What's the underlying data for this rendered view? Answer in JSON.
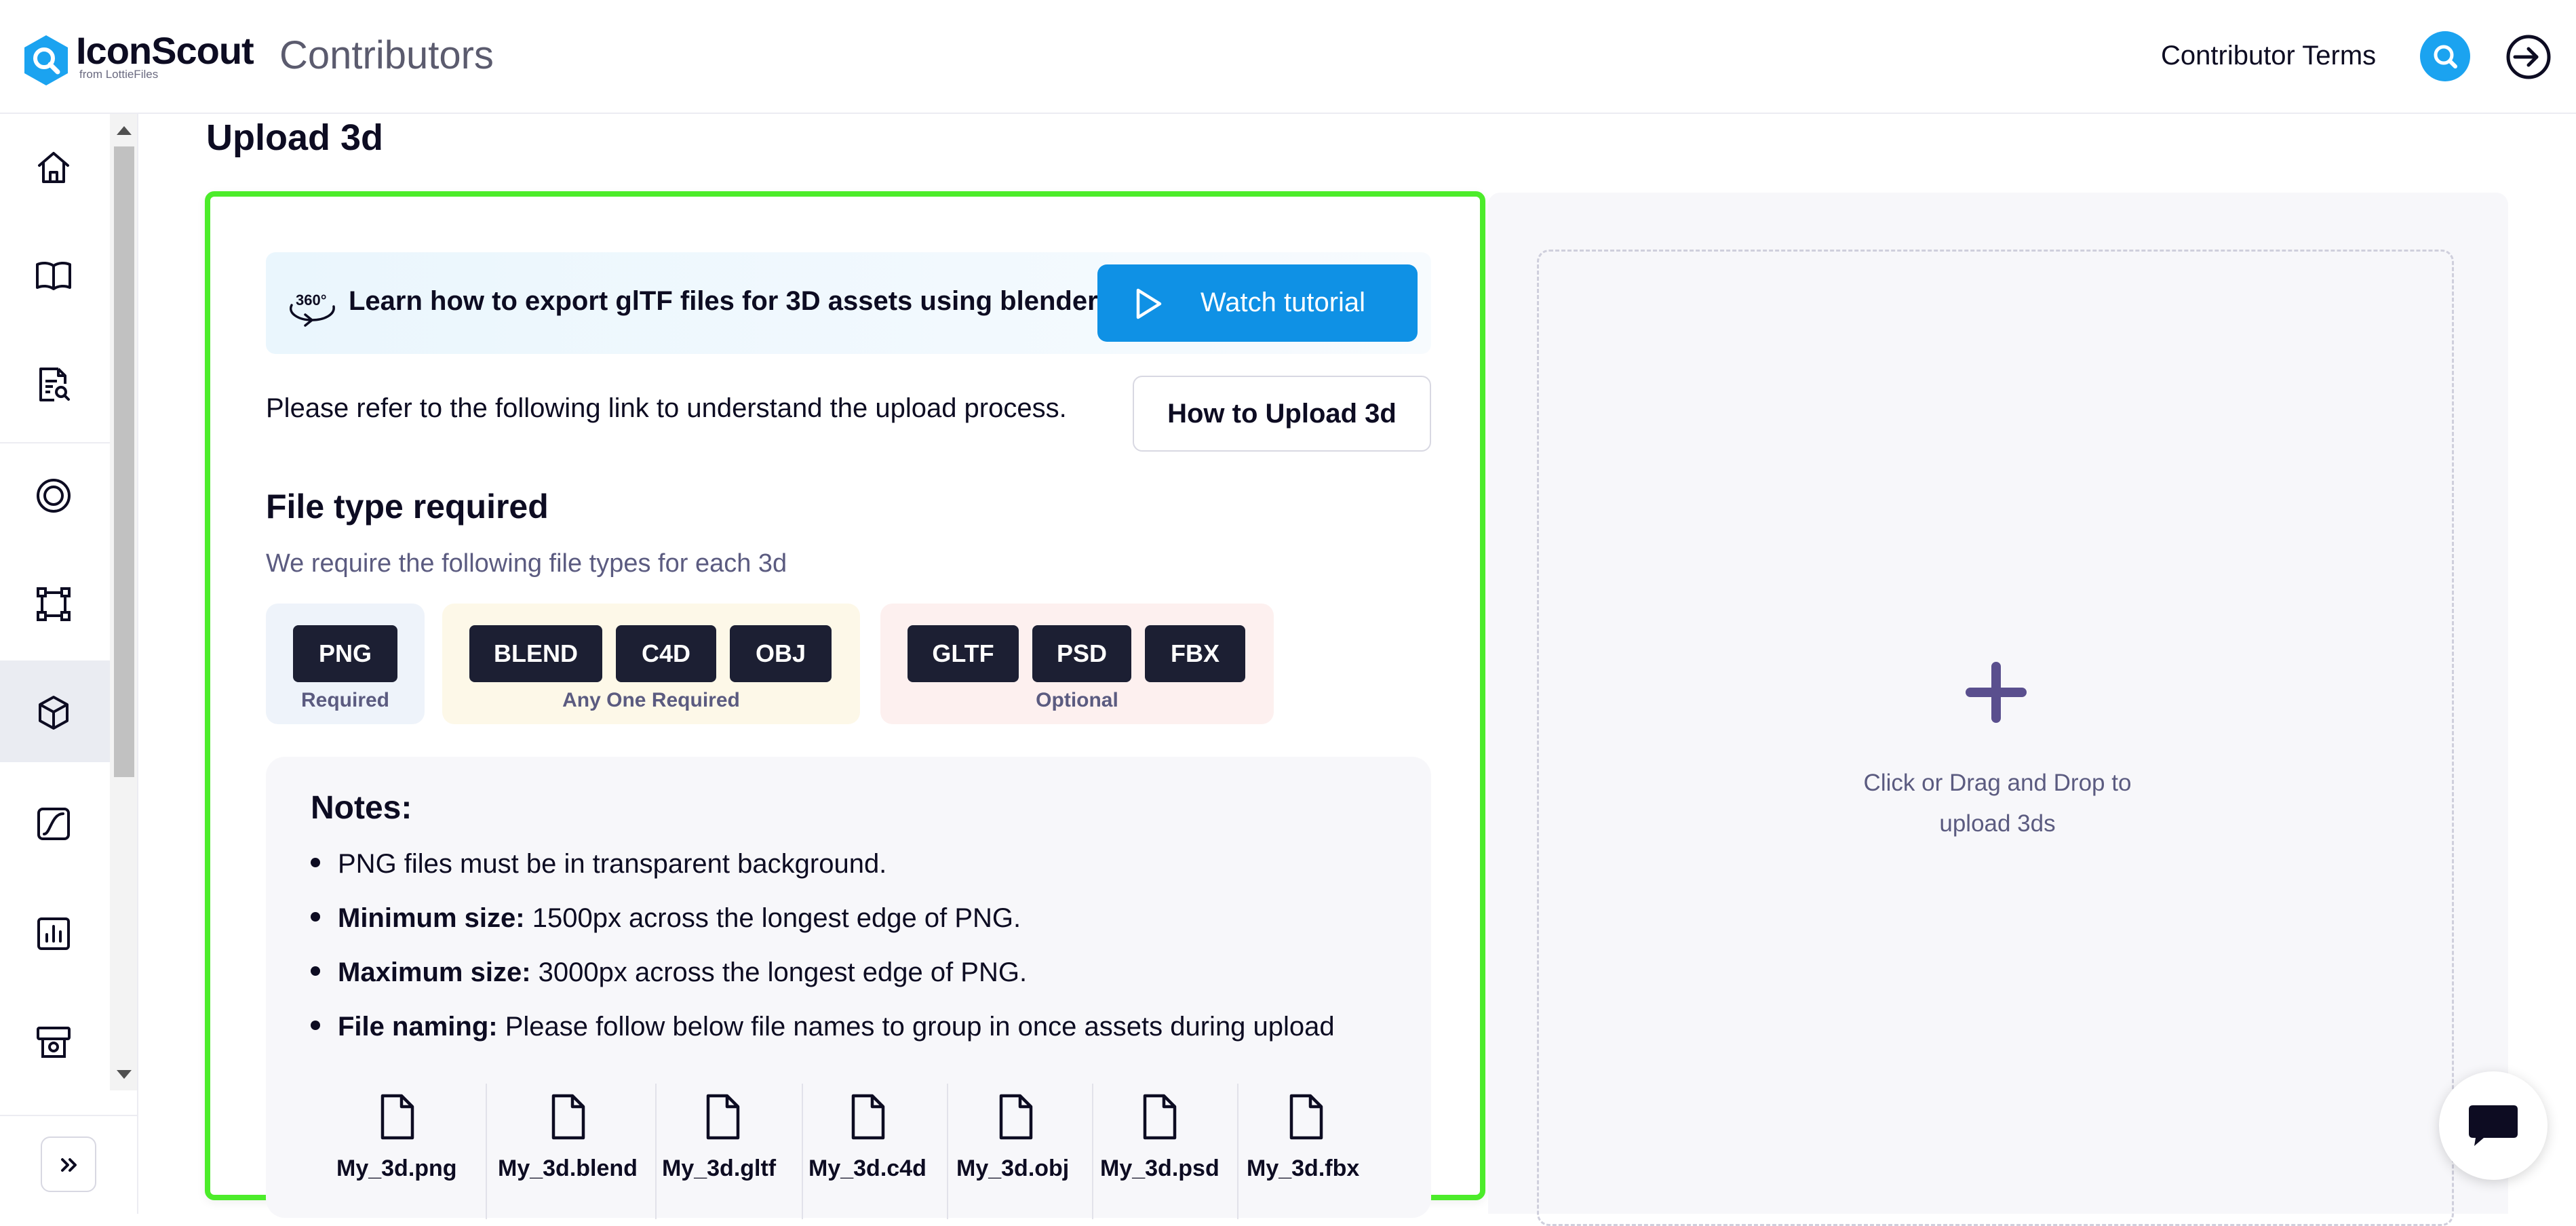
{
  "brand": {
    "name": "IconScout",
    "sub": "from LottieFiles",
    "section": "Contributors",
    "accent": "#0f91e5",
    "highlight": "#4cec2a"
  },
  "header": {
    "terms": "Contributor Terms",
    "avatar_icon": "user-avatar-icon",
    "logout_icon": "logout-icon"
  },
  "sidebar": {
    "items": [
      {
        "name": "home",
        "icon": "home-icon"
      },
      {
        "name": "guidelines",
        "icon": "open-book-icon"
      },
      {
        "name": "review",
        "icon": "document-search-icon"
      },
      {
        "name": "lottie",
        "icon": "target-icon"
      },
      {
        "name": "illustrations",
        "icon": "vector-square-icon"
      },
      {
        "name": "3d",
        "icon": "cube-icon",
        "active": true
      },
      {
        "name": "animations",
        "icon": "curve-icon"
      },
      {
        "name": "analytics",
        "icon": "bar-chart-icon"
      },
      {
        "name": "earnings",
        "icon": "atm-icon"
      }
    ],
    "expand_icon": "double-chevron-right-icon"
  },
  "page": {
    "title": "Upload 3d"
  },
  "tutorial": {
    "text": "Learn how to export glTF files for 3D assets using blender",
    "button": "Watch tutorial"
  },
  "refer": {
    "text": "Please refer to the following link to understand the upload process.",
    "button": "How to Upload 3d"
  },
  "filetypes": {
    "title": "File type required",
    "subtitle": "We require the following file types for each 3d",
    "groups": [
      {
        "caption": "Required",
        "types": [
          "PNG"
        ]
      },
      {
        "caption": "Any One Required",
        "types": [
          "BLEND",
          "C4D",
          "OBJ"
        ]
      },
      {
        "caption": "Optional",
        "types": [
          "GLTF",
          "PSD",
          "FBX"
        ]
      }
    ]
  },
  "notes": {
    "title": "Notes:",
    "items": [
      {
        "label": "",
        "text": "PNG files must be in transparent background."
      },
      {
        "label": "Minimum size:",
        "text": " 1500px across the longest edge of PNG."
      },
      {
        "label": "Maximum size:",
        "text": " 3000px across the longest edge of PNG."
      },
      {
        "label": "File naming:",
        "text": " Please follow below file names to group in once assets during upload"
      }
    ],
    "files": [
      "My_3d.png",
      "My_3d.blend",
      "My_3d.gltf",
      "My_3d.c4d",
      "My_3d.obj",
      "My_3d.psd",
      "My_3d.fbx"
    ]
  },
  "dropzone": {
    "text": "Click or Drag and Drop to upload 3ds"
  },
  "chat": {
    "icon": "chat-bubble-icon"
  }
}
